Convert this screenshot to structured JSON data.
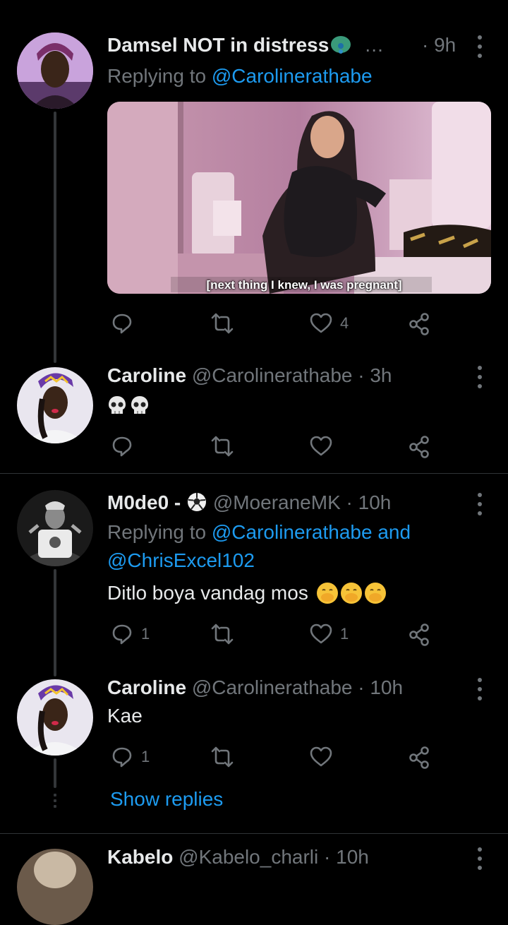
{
  "colors": {
    "background": "#000000",
    "text": "#e7e9ea",
    "muted": "#71767b",
    "link": "#1d9bf0"
  },
  "tweets": [
    {
      "name": "Damsel NOT in distress",
      "name_suffix": "…",
      "time": "· 9h",
      "replying_prefix": "Replying to",
      "replying_to": "@Carolinerathabe",
      "media_caption": "[next thing I knew, I was pregnant]",
      "actions": {
        "reply": "",
        "retweet": "",
        "like": "4"
      }
    },
    {
      "name": "Caroline",
      "handle": "@Carolinerathabe · 3h",
      "text_icons": [
        "skull-emoji",
        "skull-emoji"
      ],
      "actions": {
        "reply": "",
        "retweet": "",
        "like": ""
      }
    },
    {
      "name": "M0de0 -",
      "handle": "@MoeraneMK · 10h",
      "replying_prefix": "Replying to",
      "replying_to": "@Carolinerathabe and @ChrisExcel102",
      "text": "Ditlo boya vandag mos",
      "actions": {
        "reply": "1",
        "retweet": "",
        "like": "1"
      }
    },
    {
      "name": "Caroline",
      "handle": "@Carolinerathabe · 10h",
      "text": "Kae",
      "actions": {
        "reply": "1",
        "retweet": "",
        "like": ""
      },
      "show_replies": "Show replies"
    },
    {
      "name": "Kabelo",
      "handle": "@Kabelo_charli · 10h"
    }
  ]
}
